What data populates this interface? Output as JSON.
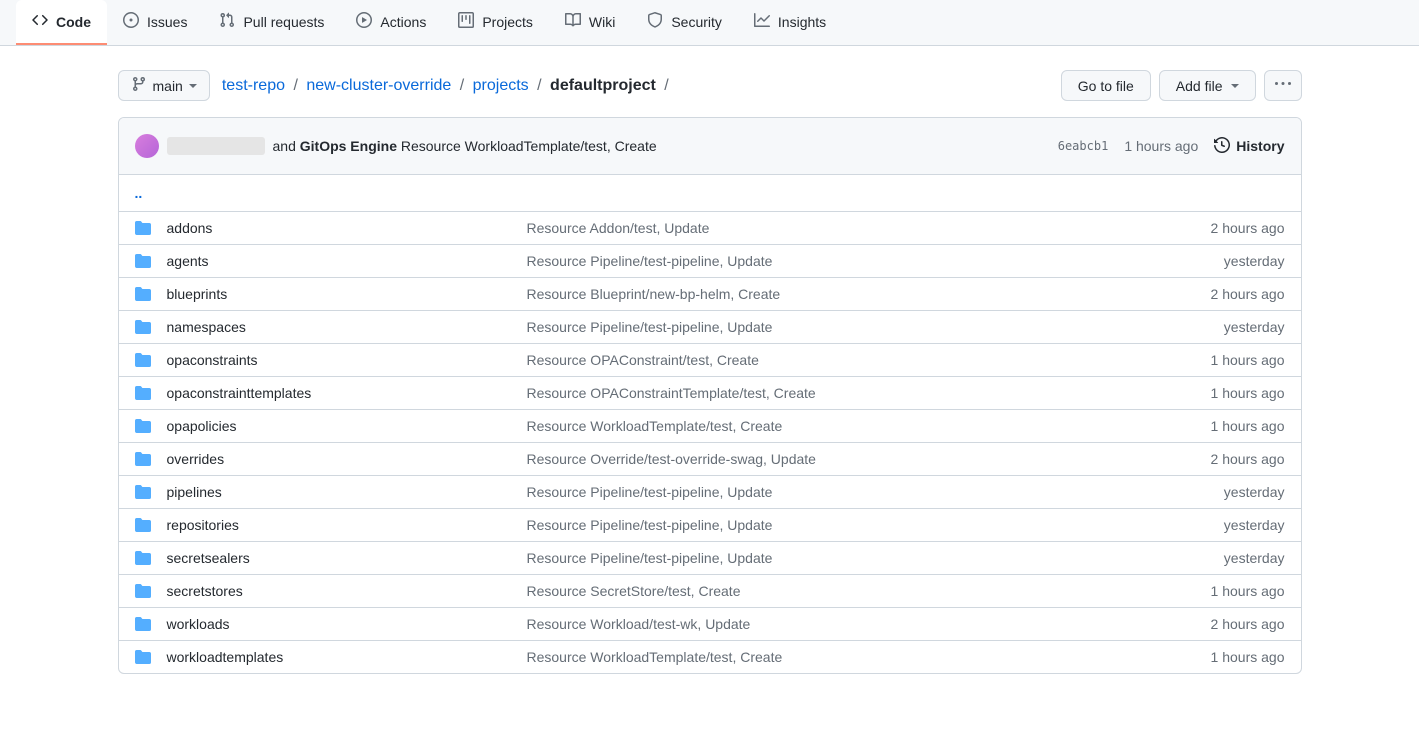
{
  "tabs": [
    {
      "label": "Code",
      "icon": "code"
    },
    {
      "label": "Issues",
      "icon": "issue"
    },
    {
      "label": "Pull requests",
      "icon": "pr"
    },
    {
      "label": "Actions",
      "icon": "play"
    },
    {
      "label": "Projects",
      "icon": "project"
    },
    {
      "label": "Wiki",
      "icon": "book"
    },
    {
      "label": "Security",
      "icon": "shield"
    },
    {
      "label": "Insights",
      "icon": "graph"
    }
  ],
  "branch": {
    "name": "main"
  },
  "breadcrumb": {
    "parts": [
      {
        "label": "test-repo",
        "link": true
      },
      {
        "label": "new-cluster-override",
        "link": true
      },
      {
        "label": "projects",
        "link": true
      },
      {
        "label": "defaultproject",
        "link": false
      }
    ]
  },
  "actions": {
    "goto": "Go to file",
    "add": "Add file"
  },
  "commit": {
    "and_text": "and",
    "bold_text": "GitOps Engine",
    "rest_text": "Resource WorkloadTemplate/test, Create",
    "sha": "6eabcb1",
    "time": "1 hours ago",
    "history": "History"
  },
  "parent_link": "..",
  "files": [
    {
      "name": "addons",
      "commit": "Resource Addon/test, Update",
      "time": "2 hours ago"
    },
    {
      "name": "agents",
      "commit": "Resource Pipeline/test-pipeline, Update",
      "time": "yesterday"
    },
    {
      "name": "blueprints",
      "commit": "Resource Blueprint/new-bp-helm, Create",
      "time": "2 hours ago"
    },
    {
      "name": "namespaces",
      "commit": "Resource Pipeline/test-pipeline, Update",
      "time": "yesterday"
    },
    {
      "name": "opaconstraints",
      "commit": "Resource OPAConstraint/test, Create",
      "time": "1 hours ago"
    },
    {
      "name": "opaconstrainttemplates",
      "commit": "Resource OPAConstraintTemplate/test, Create",
      "time": "1 hours ago"
    },
    {
      "name": "opapolicies",
      "commit": "Resource WorkloadTemplate/test, Create",
      "time": "1 hours ago"
    },
    {
      "name": "overrides",
      "commit": "Resource Override/test-override-swag, Update",
      "time": "2 hours ago"
    },
    {
      "name": "pipelines",
      "commit": "Resource Pipeline/test-pipeline, Update",
      "time": "yesterday"
    },
    {
      "name": "repositories",
      "commit": "Resource Pipeline/test-pipeline, Update",
      "time": "yesterday"
    },
    {
      "name": "secretsealers",
      "commit": "Resource Pipeline/test-pipeline, Update",
      "time": "yesterday"
    },
    {
      "name": "secretstores",
      "commit": "Resource SecretStore/test, Create",
      "time": "1 hours ago"
    },
    {
      "name": "workloads",
      "commit": "Resource Workload/test-wk, Update",
      "time": "2 hours ago"
    },
    {
      "name": "workloadtemplates",
      "commit": "Resource WorkloadTemplate/test, Create",
      "time": "1 hours ago"
    }
  ]
}
